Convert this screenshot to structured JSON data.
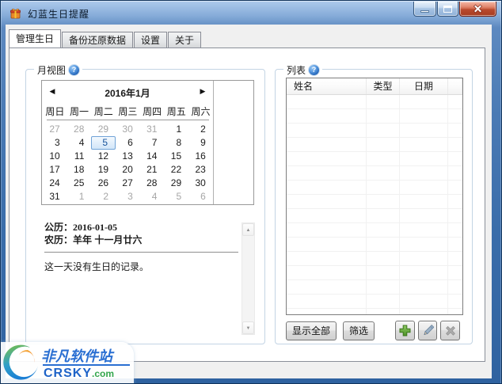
{
  "window": {
    "title": "幻蓝生日提醒"
  },
  "tabs": [
    {
      "label": "管理生日",
      "active": true
    },
    {
      "label": "备份还原数据",
      "active": false
    },
    {
      "label": "设置",
      "active": false
    },
    {
      "label": "关于",
      "active": false
    }
  ],
  "icons": {
    "help": "?",
    "prev": "◀",
    "next": "▶",
    "scroll_up": "▲",
    "scroll_down": "▼"
  },
  "month_view": {
    "label": "月视图",
    "calendar": {
      "title": "2016年1月",
      "weekdays": [
        "周日",
        "周一",
        "周二",
        "周三",
        "周四",
        "周五",
        "周六"
      ],
      "selected_date": "2016-01-05",
      "weeks": [
        [
          {
            "d": "27",
            "s": "m"
          },
          {
            "d": "28",
            "s": "m"
          },
          {
            "d": "29",
            "s": "m"
          },
          {
            "d": "30",
            "s": "m"
          },
          {
            "d": "31",
            "s": "m"
          },
          {
            "d": "1"
          },
          {
            "d": "2"
          }
        ],
        [
          {
            "d": "3"
          },
          {
            "d": "4"
          },
          {
            "d": "5",
            "s": "sel"
          },
          {
            "d": "6"
          },
          {
            "d": "7"
          },
          {
            "d": "8"
          },
          {
            "d": "9"
          }
        ],
        [
          {
            "d": "10"
          },
          {
            "d": "11"
          },
          {
            "d": "12"
          },
          {
            "d": "13"
          },
          {
            "d": "14"
          },
          {
            "d": "15"
          },
          {
            "d": "16"
          }
        ],
        [
          {
            "d": "17"
          },
          {
            "d": "18"
          },
          {
            "d": "19"
          },
          {
            "d": "20"
          },
          {
            "d": "21"
          },
          {
            "d": "22"
          },
          {
            "d": "23"
          }
        ],
        [
          {
            "d": "24"
          },
          {
            "d": "25"
          },
          {
            "d": "26"
          },
          {
            "d": "27"
          },
          {
            "d": "28"
          },
          {
            "d": "29"
          },
          {
            "d": "30"
          }
        ],
        [
          {
            "d": "31"
          },
          {
            "d": "1",
            "s": "m"
          },
          {
            "d": "2",
            "s": "m"
          },
          {
            "d": "3",
            "s": "m"
          },
          {
            "d": "4",
            "s": "m"
          },
          {
            "d": "5",
            "s": "m"
          },
          {
            "d": "6",
            "s": "m"
          }
        ]
      ]
    },
    "info": {
      "solar_label": "公历：",
      "solar_value": "2016-01-05",
      "lunar_label": "农历：",
      "lunar_value": "羊年 十一月廿六",
      "empty_message": "这一天没有生日的记录。"
    }
  },
  "list_panel": {
    "label": "列表",
    "columns": [
      "姓名",
      "类型",
      "日期"
    ],
    "rows": [],
    "empty_row_count": 16,
    "buttons": {
      "show_all": "显示全部",
      "filter": "筛选"
    }
  },
  "watermark": {
    "name": "非凡软件站",
    "domain": "CRSKY",
    "suffix": ".com"
  },
  "colors": {
    "titlebar_blue": "#4a7ab4",
    "selection_blue": "#70a3d7",
    "group_border": "#c3d4e4",
    "plus_green": "#61a335",
    "close_red": "#b94a2e"
  }
}
